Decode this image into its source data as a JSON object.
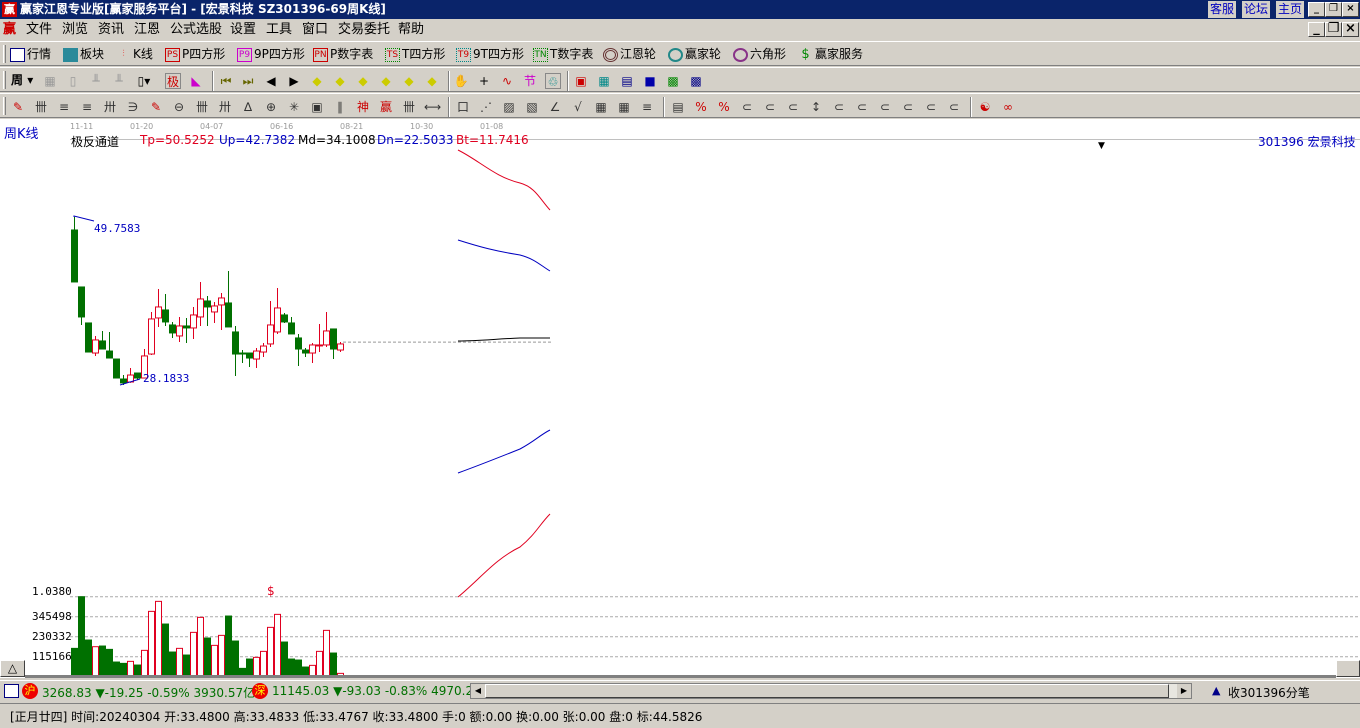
{
  "title": {
    "text": "赢家江恩专业版[赢家服务平台] - [宏景科技   SZ301396-69周K线]",
    "logo": "赢",
    "links": [
      "客服",
      "论坛",
      "主页"
    ]
  },
  "menu": {
    "logo": "赢",
    "items": [
      "文件",
      "浏览",
      "资讯",
      "江恩",
      "公式选股",
      "设置",
      "工具",
      "窗口",
      "交易委托",
      "帮助"
    ]
  },
  "toolbar1": [
    {
      "icon": "PS",
      "label": "行情"
    },
    {
      "label": "板块"
    },
    {
      "label": "K线"
    },
    {
      "icon": "PS",
      "label": "P四方形"
    },
    {
      "icon": "P9",
      "label": "9P四方形"
    },
    {
      "icon": "PN",
      "label": "P数字表"
    },
    {
      "icon": "TS",
      "label": "T四方形"
    },
    {
      "icon": "T9",
      "label": "9T四方形"
    },
    {
      "icon": "TN",
      "label": "T数字表"
    },
    {
      "label": "江恩轮"
    },
    {
      "label": "赢家轮"
    },
    {
      "label": "六角形"
    },
    {
      "label": "赢家服务"
    }
  ],
  "toolbar2": {
    "period": "周"
  },
  "chart": {
    "period_label": "周K线",
    "dates": [
      "11-11",
      "01-20",
      "04-07",
      "06-16",
      "08-21",
      "10-30",
      "01-08"
    ],
    "indicator_name": "极反通道",
    "tp": "Tp=50.5252",
    "up": "Up=42.7382",
    "md": "Md=34.1008",
    "dn": "Dn=22.5033",
    "bt": "Bt=11.7416",
    "stock": "301396  宏景科技",
    "high_label": "49.7583",
    "low_label": "28.1833",
    "candles": [
      [
        48.07,
        49.76,
        41.31,
        41.31
      ],
      [
        40.66,
        40.66,
        35.72,
        36.76
      ],
      [
        35.98,
        35.98,
        32.2,
        32.2
      ],
      [
        32.07,
        34.29,
        31.69,
        33.77
      ],
      [
        33.64,
        34.94,
        32.59,
        32.59
      ],
      [
        32.33,
        34.81,
        31.42,
        31.42
      ],
      [
        31.29,
        31.29,
        28.82,
        28.82
      ],
      [
        28.69,
        29.21,
        27.91,
        28.18
      ],
      [
        28.3,
        30.12,
        28.18,
        29.21
      ],
      [
        29.47,
        29.47,
        28.56,
        28.82
      ],
      [
        28.82,
        32.59,
        28.82,
        31.69
      ],
      [
        31.94,
        37.41,
        31.81,
        36.5
      ],
      [
        36.63,
        40.4,
        35.46,
        38.06
      ],
      [
        37.67,
        39.75,
        35.59,
        36.11
      ],
      [
        35.72,
        36.11,
        34.03,
        34.68
      ],
      [
        34.29,
        36.76,
        33.51,
        35.59
      ],
      [
        35.59,
        36.63,
        33.38,
        35.33
      ],
      [
        35.33,
        38.06,
        33.9,
        37.02
      ],
      [
        36.76,
        41.31,
        35.59,
        39.1
      ],
      [
        38.84,
        39.49,
        35.59,
        38.06
      ],
      [
        37.41,
        38.71,
        35.98,
        38.19
      ],
      [
        38.32,
        39.88,
        35.07,
        39.23
      ],
      [
        38.58,
        42.74,
        35.46,
        35.46
      ],
      [
        34.81,
        35.59,
        29.08,
        31.94
      ],
      [
        32.07,
        32.46,
        30.77,
        31.94
      ],
      [
        32.07,
        32.07,
        30.25,
        31.42
      ],
      [
        31.29,
        32.72,
        30.12,
        32.33
      ],
      [
        32.2,
        33.38,
        31.55,
        32.98
      ],
      [
        33.25,
        38.84,
        32.85,
        35.72
      ],
      [
        34.81,
        40.53,
        34.55,
        37.93
      ],
      [
        37.02,
        37.28,
        35.98,
        36.11
      ],
      [
        35.98,
        36.76,
        34.55,
        34.55
      ],
      [
        34.03,
        34.55,
        30.38,
        32.59
      ],
      [
        32.46,
        32.72,
        31.55,
        32.07
      ],
      [
        32.07,
        33.38,
        30.77,
        33.12
      ],
      [
        33.12,
        35.85,
        32.2,
        33.12
      ],
      [
        33.12,
        37.41,
        32.85,
        34.94
      ],
      [
        35.2,
        35.2,
        31.29,
        32.59
      ],
      [
        32.46,
        33.51,
        32.2,
        33.25
      ]
    ],
    "last_close": 33.48
  },
  "volume": {
    "labels": [
      "1.0380",
      "345498",
      "230332",
      "115166"
    ],
    "marker": "$",
    "values": [
      163150,
      460660,
      211140,
      172750,
      176590,
      157390,
      84460,
      76780,
      88300,
      67180,
      151640,
      376220,
      433800,
      303270,
      142040,
      163150,
      124770,
      255290,
      341660,
      222660,
      180430,
      238010,
      349340,
      205380,
      47990,
      101730,
      111330,
      145880,
      284080,
      358940,
      199620,
      101730,
      95970,
      55660,
      65260,
      145880,
      266810,
      136280,
      19190
    ]
  },
  "status1": {
    "sh_badge": "沪",
    "sh": "3268.83",
    "sh_chg": "▼-19.25",
    "sh_pct": "-0.59%",
    "sh_amt": "3930.57亿",
    "sz_badge": "深",
    "sz": "11145.03",
    "sz_chg": "▼-93.03",
    "sz_pct": "-0.83%",
    "sz_amt": "4970.2",
    "right": "收301396分笔"
  },
  "status2": {
    "text": "[正月廿四] 时间:20240304 开:33.4800 高:33.4833 低:33.4767 收:33.4800 手:0 额:0.00 换:0.00 张:0.00 盘:0 标:44.5826"
  },
  "colors": {
    "up": "#e00020",
    "down": "#007000",
    "title": "#0a246a"
  }
}
